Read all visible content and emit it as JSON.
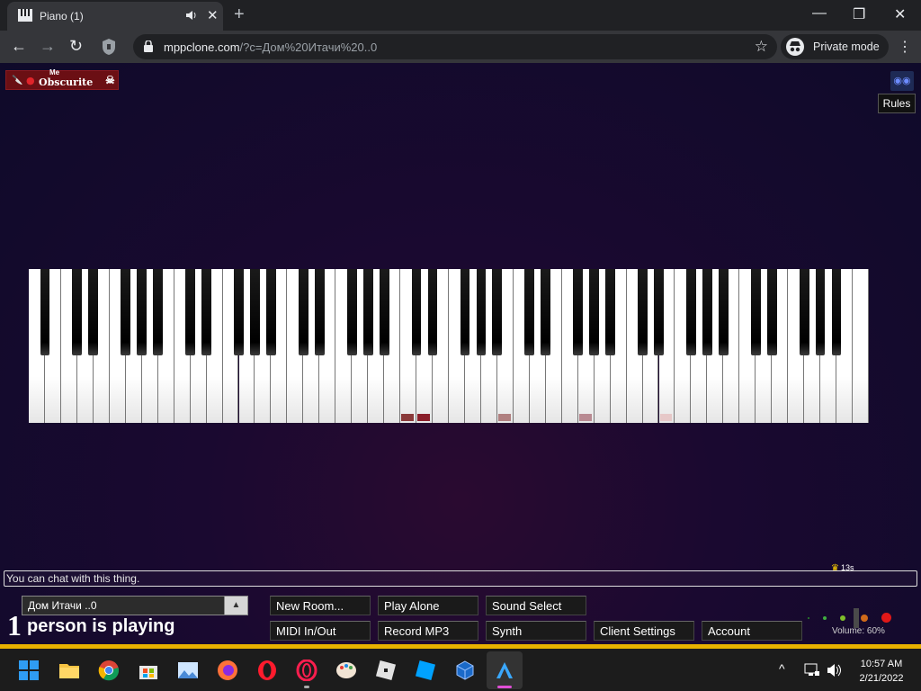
{
  "browser": {
    "tab_title": "Piano (1)",
    "close_glyph": "✕",
    "new_tab_glyph": "+",
    "window_controls": {
      "minimize": "—",
      "restore": "❐",
      "close": "✕"
    },
    "nav": {
      "back": "←",
      "forward": "→",
      "reload": "↻"
    },
    "url_host": "mppclone.com",
    "url_path": "/?c=Дом%20Итачи%20..0",
    "bookmark_glyph": "☆",
    "private_label": "Private mode",
    "menu_glyph": "⋮"
  },
  "page": {
    "logo": {
      "me": "Me",
      "name": "Obscurite"
    },
    "rules_label": "Rules",
    "chat_placeholder": "You can chat with this thing.",
    "crown_time": "13s",
    "room_name": "Дом Итачи ..0",
    "room_arrow": "▲",
    "players_count": "1",
    "players_text": "person is playing",
    "buttons_row1": [
      "New Room...",
      "Play Alone",
      "Sound Select"
    ],
    "buttons_row2": [
      "MIDI In/Out",
      "Record MP3",
      "Synth",
      "Client Settings",
      "Account"
    ],
    "volume_label": "Volume: 60%",
    "volume_level": 0.6
  },
  "piano": {
    "white_keys": 52,
    "pressed_marks": [
      {
        "white_index": 23,
        "color": "#8a3a3a"
      },
      {
        "white_index": 24,
        "color": "#8a1f2a"
      },
      {
        "white_index": 29,
        "color": "#b08080"
      },
      {
        "white_index": 34,
        "color": "#b88a92"
      },
      {
        "white_index": 39,
        "color": "#e6c8c8"
      }
    ]
  },
  "taskbar": {
    "icons": [
      "windows-start-icon",
      "file-explorer-icon",
      "chrome-icon",
      "store-icon",
      "photos-icon",
      "firefox-icon",
      "opera-icon",
      "opera-gx-icon",
      "paint-icon",
      "roblox-icon",
      "roblox-studio-icon",
      "virtualbox-icon",
      "app-a-icon"
    ],
    "tray": "^",
    "time": "10:57 AM",
    "date": "2/21/2022"
  },
  "colors": {
    "accent": "#e8b100",
    "page_bg": "#1a0930"
  }
}
